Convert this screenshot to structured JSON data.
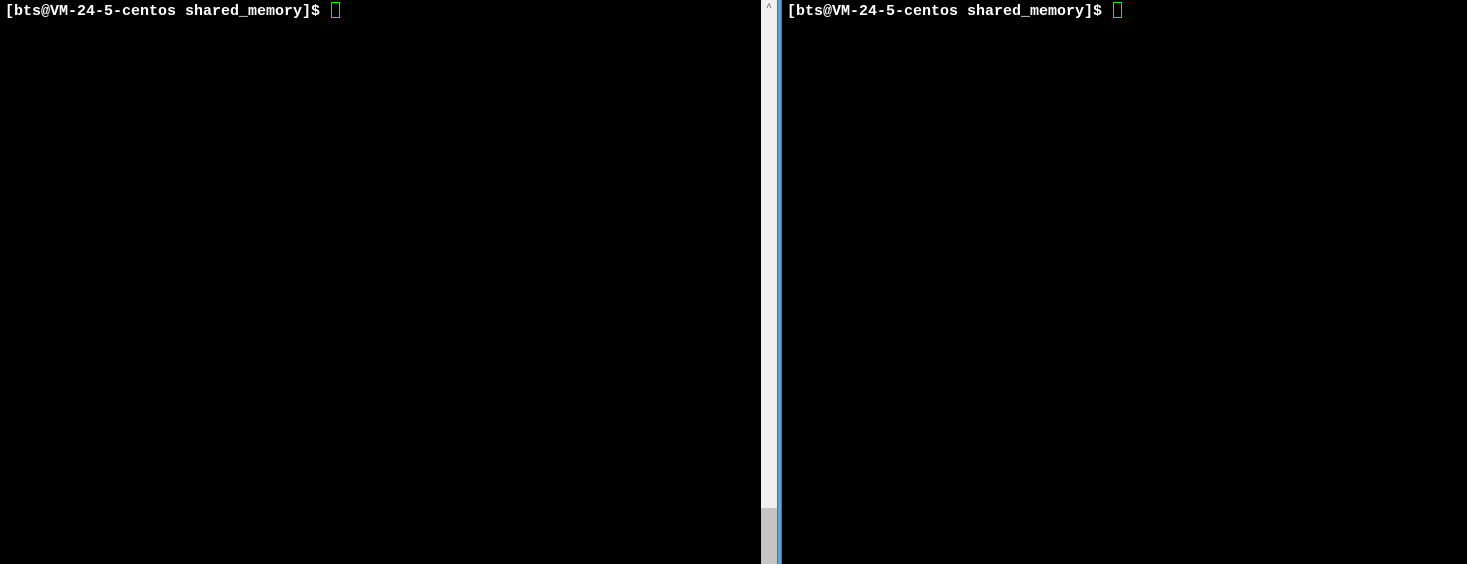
{
  "left_pane": {
    "prompt": "[bts@VM-24-5-centos shared_memory]$ "
  },
  "right_pane": {
    "prompt": "[bts@VM-24-5-centos shared_memory]$ "
  },
  "scrollbar": {
    "arrow_up": "^"
  }
}
